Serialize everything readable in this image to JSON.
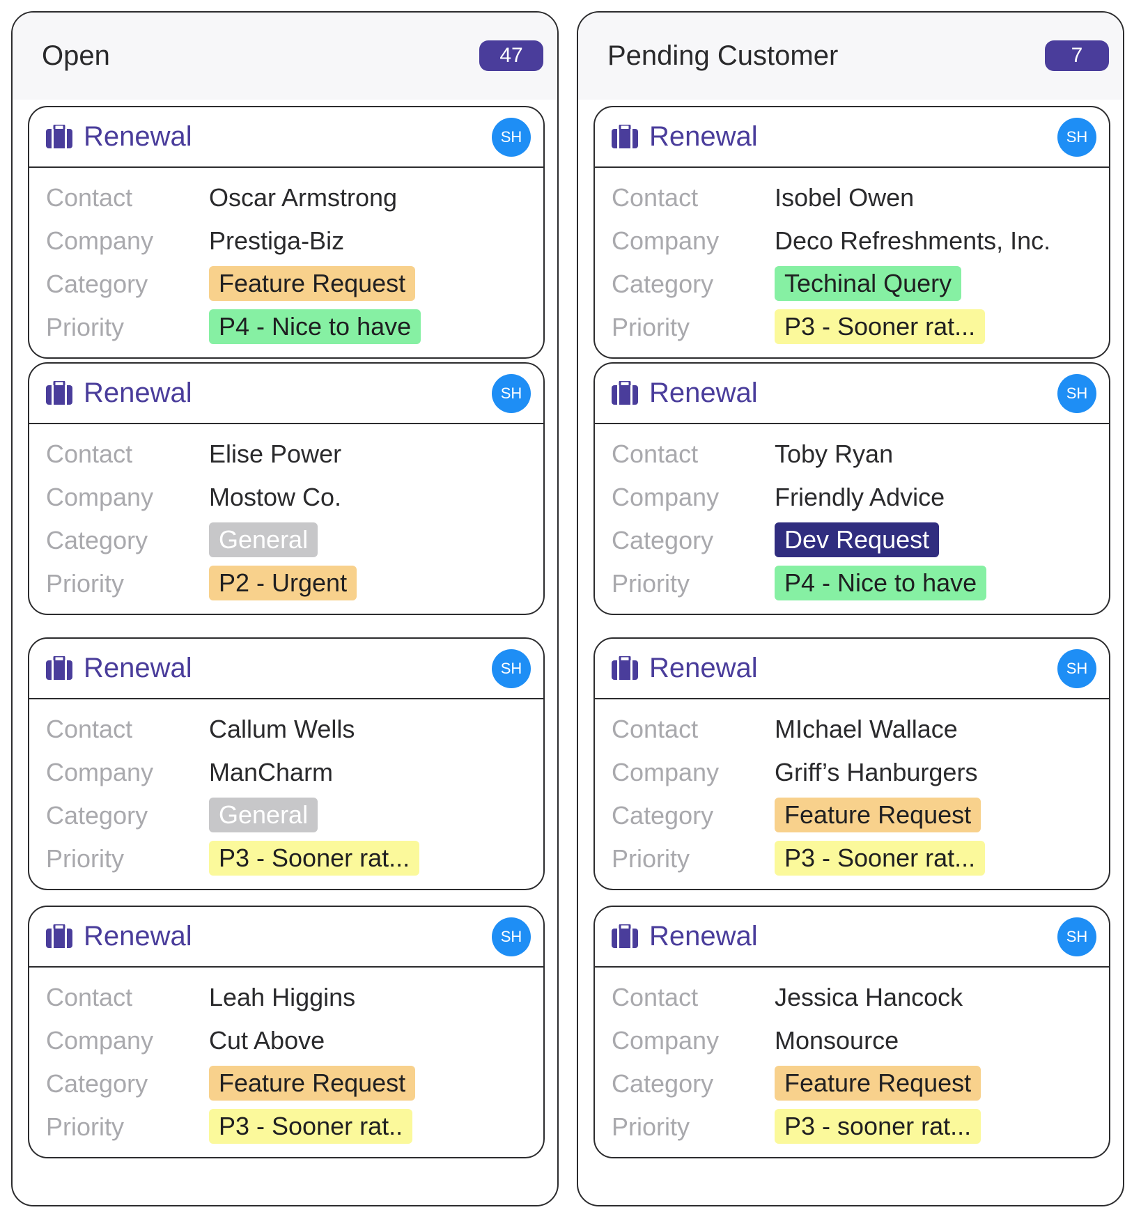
{
  "colors": {
    "accent": "#4a3d9b",
    "avatar": "#1e8ef5",
    "feature_request": "#f8d18c",
    "technical_query": "#86f0a3",
    "general": "#c7c7c9",
    "dev_request": "#302d7f",
    "p2": "#f8d18c",
    "p3": "#fbf99b",
    "p4": "#86f0a3"
  },
  "labels": {
    "contact": "Contact",
    "company": "Company",
    "category": "Category",
    "priority": "Priority"
  },
  "columns": [
    {
      "title": "Open",
      "count": "47",
      "cards": [
        {
          "icon": "briefcase-icon",
          "title": "Renewal",
          "avatar": "SH",
          "contact": "Oscar Armstrong",
          "company": "Prestiga-Biz",
          "category": "Feature Request",
          "category_style": "orange",
          "priority": "P4 - Nice to have",
          "priority_style": "green"
        },
        {
          "icon": "briefcase-icon",
          "title": "Renewal",
          "avatar": "SH",
          "contact": "Elise Power",
          "company": "Mostow Co.",
          "category": "General",
          "category_style": "gray",
          "priority": "P2 - Urgent",
          "priority_style": "orange"
        },
        {
          "icon": "briefcase-icon",
          "title": "Renewal",
          "avatar": "SH",
          "contact": "Callum Wells",
          "company": "ManCharm",
          "category": "General",
          "category_style": "gray",
          "priority": "P3 - Sooner rat...",
          "priority_style": "yellow"
        },
        {
          "icon": "briefcase-icon",
          "title": "Renewal",
          "avatar": "SH",
          "contact": "Leah Higgins",
          "company": "Cut Above",
          "category": "Feature Request",
          "category_style": "orange",
          "priority": "P3 - Sooner rat..",
          "priority_style": "yellow"
        }
      ]
    },
    {
      "title": "Pending Customer",
      "count": "7",
      "cards": [
        {
          "icon": "briefcase-icon",
          "title": "Renewal",
          "avatar": "SH",
          "contact": "Isobel Owen",
          "company": "Deco Refreshments, Inc.",
          "category": "Techinal Query",
          "category_style": "green",
          "priority": "P3 - Sooner rat...",
          "priority_style": "yellow"
        },
        {
          "icon": "briefcase-icon",
          "title": "Renewal",
          "avatar": "SH",
          "contact": "Toby Ryan",
          "company": "Friendly Advice",
          "category": "Dev Request",
          "category_style": "navy",
          "priority": "P4 - Nice to have",
          "priority_style": "green"
        },
        {
          "icon": "briefcase-icon",
          "title": "Renewal",
          "avatar": "SH",
          "contact": "MIchael Wallace",
          "company": "Griff’s Hanburgers",
          "category": "Feature Request",
          "category_style": "orange",
          "priority": "P3 - Sooner rat...",
          "priority_style": "yellow"
        },
        {
          "icon": "briefcase-icon",
          "title": "Renewal",
          "avatar": "SH",
          "contact": "Jessica Hancock",
          "company": "Monsource",
          "category": "Feature Request",
          "category_style": "orange",
          "priority": "P3 - sooner rat...",
          "priority_style": "yellow"
        }
      ]
    }
  ]
}
